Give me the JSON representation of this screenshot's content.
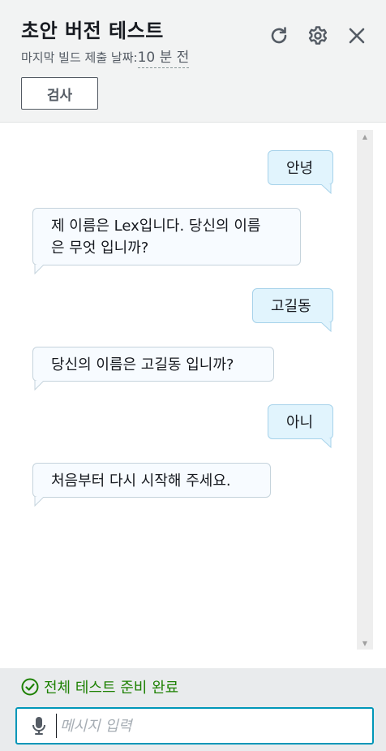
{
  "header": {
    "title": "초안 버전 테스트",
    "subtitle_prefix": "마지막 빌드 제출 날짜:",
    "subtitle_ago": "10 분 전",
    "inspect_label": "검사",
    "icons": [
      "refresh-icon",
      "settings-icon",
      "close-icon"
    ]
  },
  "messages": [
    {
      "sender": "user",
      "text": "안녕"
    },
    {
      "sender": "bot",
      "line1": "제 이름은 Lex입니다. 당신의 이름",
      "line2": "은 무엇 입니까?"
    },
    {
      "sender": "user",
      "text": "고길동"
    },
    {
      "sender": "bot",
      "text": "당신의 이름은 고길동 입니까?"
    },
    {
      "sender": "user",
      "text": "아니"
    },
    {
      "sender": "bot",
      "text": "처음부터 다시 시작해 주세요."
    }
  ],
  "footer": {
    "status": "전체 테스트 준비 완료",
    "input_placeholder": "메시지 입력",
    "input_value": ""
  },
  "colors": {
    "accent": "#0097b8",
    "success": "#1d8102",
    "user_bubble": "#e1f4fd",
    "bot_bubble": "#f7fbff"
  }
}
